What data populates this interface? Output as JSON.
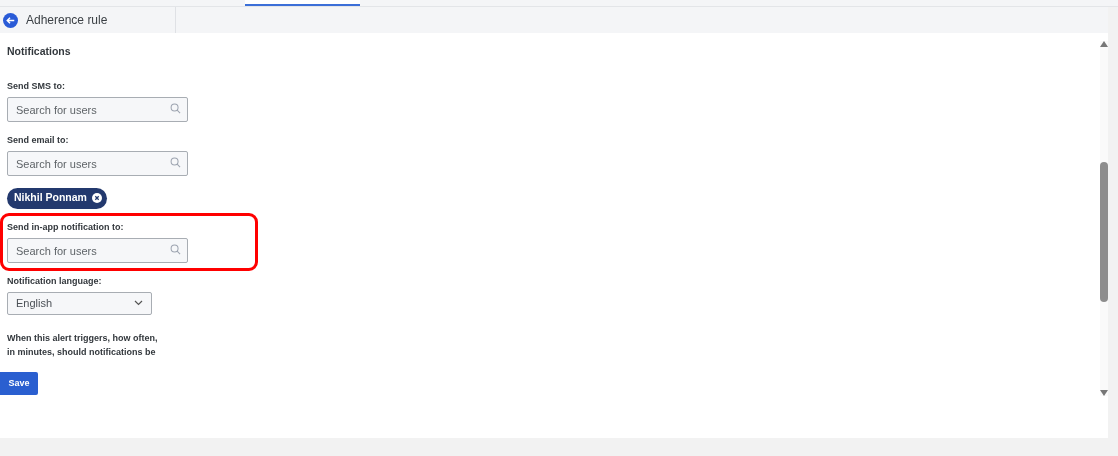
{
  "header": {
    "title": "Adherence rule"
  },
  "section_title": "Notifications",
  "fields": [
    {
      "kind": "search",
      "label": "Send SMS to:",
      "placeholder": "Search for users",
      "highlighted": false
    },
    {
      "kind": "search",
      "label": "Send email to:",
      "placeholder": "Search for users",
      "chips": [
        "Nikhil Ponnam"
      ],
      "highlighted": false
    },
    {
      "kind": "search",
      "label": "Send in-app notification to:",
      "placeholder": "Search for users",
      "highlighted": true
    },
    {
      "kind": "select",
      "label": "Notification language:",
      "value": "English"
    }
  ],
  "question": [
    "When this alert triggers, how often,",
    "in minutes, should notifications be"
  ],
  "save_button": "Save"
}
